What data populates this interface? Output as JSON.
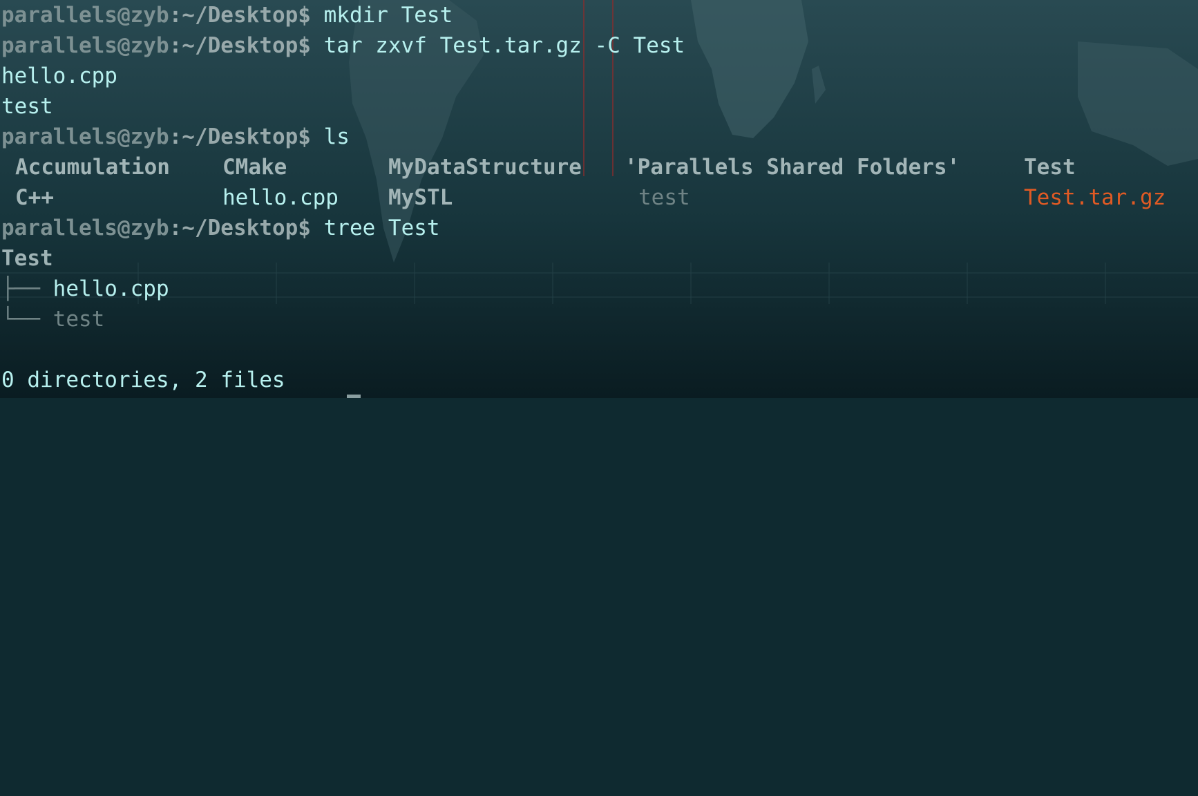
{
  "terminal": {
    "prompt_user": "parallels@zyb",
    "prompt_path": ":~/Desktop$",
    "commands": {
      "c1": " mkdir Test",
      "c2": " tar zxvf Test.tar.gz -C Test",
      "c3": " ls",
      "c4": " tree Test"
    },
    "tar_output": [
      "hello.cpp",
      "test"
    ],
    "ls_row1": [
      "Accumulation",
      "CMake",
      "MyDataStructure",
      "'Parallels Shared Folders'",
      "Test"
    ],
    "ls_row2": [
      "C++",
      "hello.cpp",
      "MySTL",
      "test",
      "Test.tar.gz"
    ],
    "tree": {
      "root": "Test",
      "branch_mid": "├── ",
      "branch_last": "└── ",
      "items": [
        "hello.cpp",
        "test"
      ],
      "summary": "0 directories, 2 files"
    }
  },
  "colors": {
    "background": "#0f2a30",
    "text": "#b7f0ee",
    "archive": "#e05a24"
  }
}
